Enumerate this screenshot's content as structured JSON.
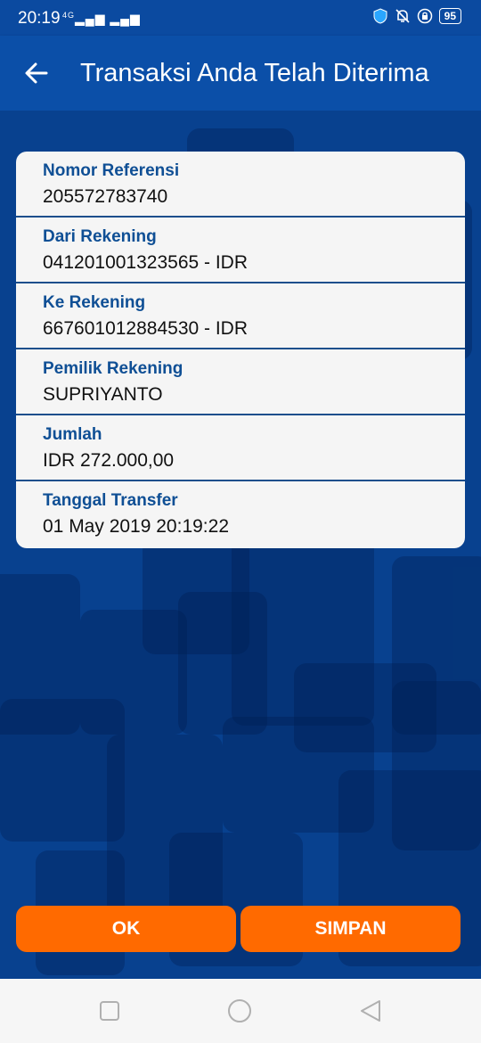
{
  "status_bar": {
    "time": "20:19",
    "network": "4G",
    "battery": "95"
  },
  "header": {
    "title": "Transaksi Anda Telah Diterima"
  },
  "details": [
    {
      "label": "Nomor Referensi",
      "value": "205572783740"
    },
    {
      "label": "Dari Rekening",
      "value": "041201001323565 - IDR"
    },
    {
      "label": "Ke Rekening",
      "value": "667601012884530 - IDR"
    },
    {
      "label": "Pemilik Rekening",
      "value": "SUPRIYANTO"
    },
    {
      "label": "Jumlah",
      "value": "IDR 272.000,00"
    },
    {
      "label": "Tanggal Transfer",
      "value": "01 May 2019 20:19:22"
    }
  ],
  "actions": {
    "ok_label": "OK",
    "save_label": "SIMPAN"
  },
  "colors": {
    "primary": "#0b4fa8",
    "accent": "#ff6a00",
    "label": "#0f4f95"
  }
}
